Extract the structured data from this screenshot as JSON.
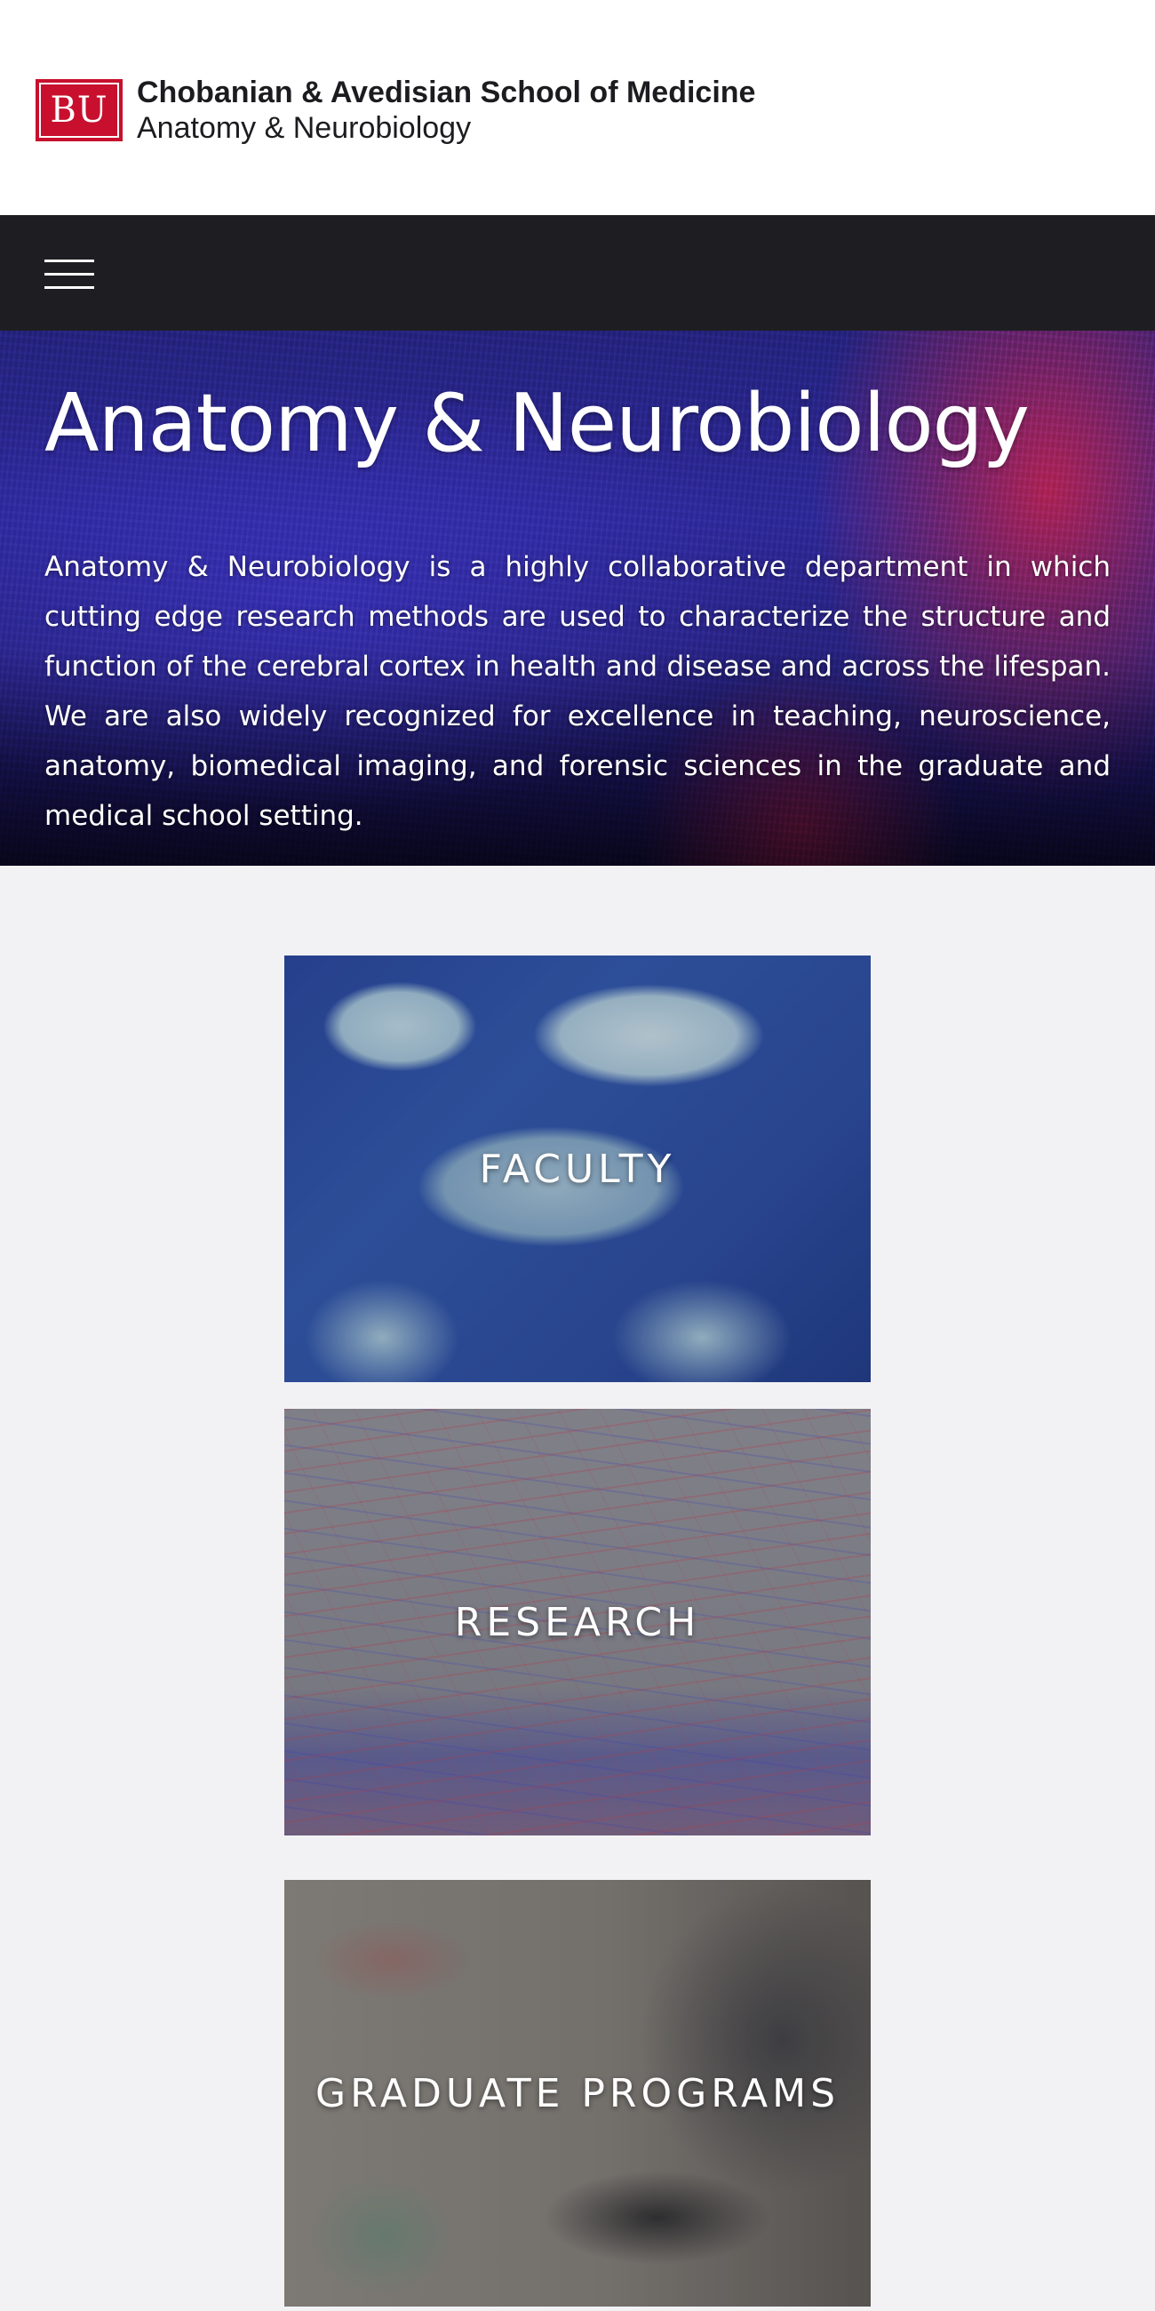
{
  "header": {
    "logo_text": "BU",
    "school_name": "Chobanian & Avedisian School of Medicine",
    "department_name": "Anatomy & Neurobiology"
  },
  "nav": {
    "menu_icon": "hamburger-menu-icon"
  },
  "hero": {
    "title": "Anatomy & Neurobiology",
    "description": "Anatomy & Neurobiology is a highly collaborative department in which cutting edge research methods are used to characterize the structure and function of the cerebral cortex in health and disease and across the lifespan. We are also widely recognized for excellence in teaching, neuroscience, anatomy, biomedical imaging, and forensic sciences in the graduate and medical school setting."
  },
  "tiles": [
    {
      "label": "FACULTY"
    },
    {
      "label": "RESEARCH"
    },
    {
      "label": "GRADUATE PROGRAMS"
    }
  ],
  "colors": {
    "brand_red": "#c8102e",
    "nav_background": "#1e1e22",
    "page_background": "#f2f2f4"
  }
}
